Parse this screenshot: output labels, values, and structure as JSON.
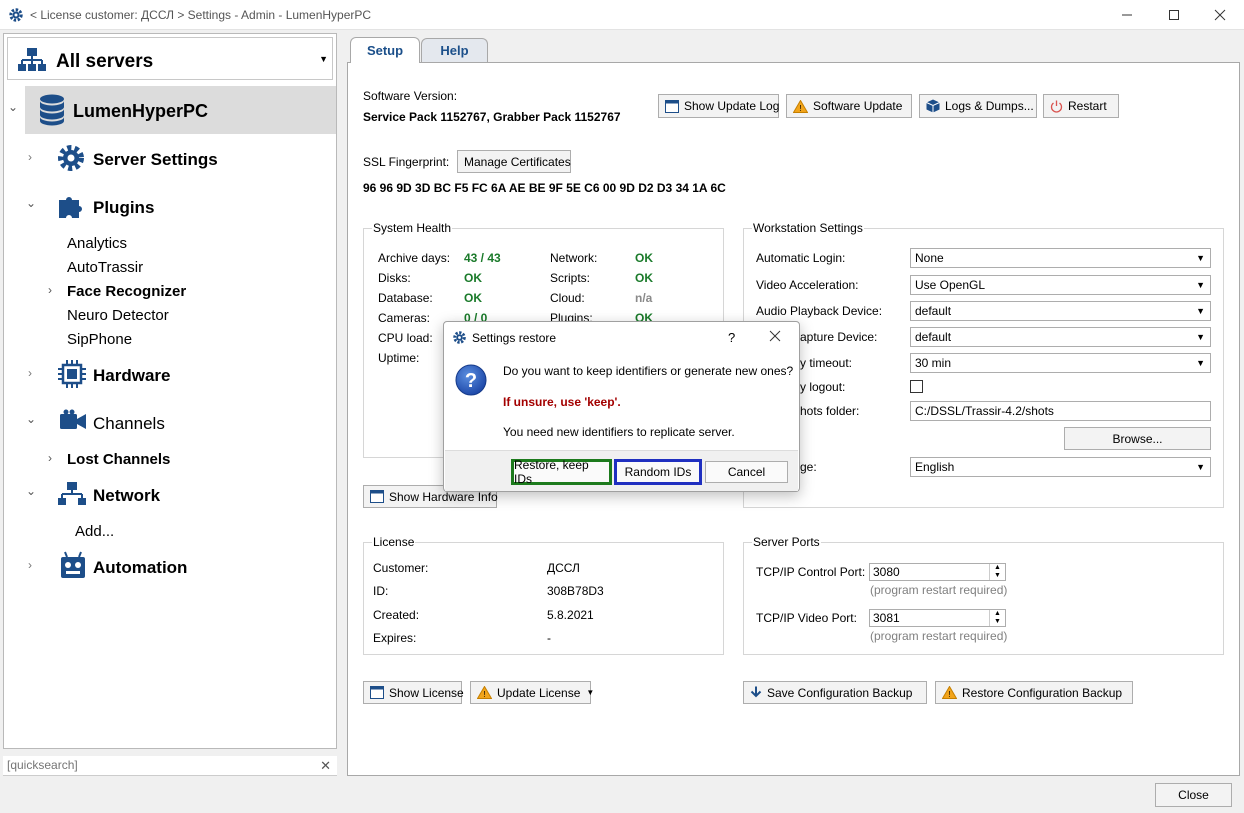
{
  "window": {
    "title": "< License customer: ДССЛ > Settings - Admin - LumenHyperPC"
  },
  "sidebar": {
    "server_selector": "All servers",
    "tree": [
      {
        "label": "LumenHyperPC"
      },
      {
        "label": "Server Settings"
      },
      {
        "label": "Plugins"
      },
      {
        "label": "Analytics"
      },
      {
        "label": "AutoTrassir"
      },
      {
        "label": "Face Recognizer"
      },
      {
        "label": "Neuro Detector"
      },
      {
        "label": "SipPhone"
      },
      {
        "label": "Hardware"
      },
      {
        "label": "Channels"
      },
      {
        "label": "Lost Channels"
      },
      {
        "label": "Network"
      },
      {
        "label": "Add..."
      },
      {
        "label": "Automation"
      }
    ],
    "quicksearch_placeholder": "[quicksearch]"
  },
  "tabs": [
    {
      "label": "Setup",
      "active": true
    },
    {
      "label": "Help",
      "active": false
    }
  ],
  "software": {
    "version_label": "Software Version:",
    "version_value": "Service Pack 1152767, Grabber Pack 1152767",
    "buttons": {
      "show_update_log": "Show Update Log",
      "software_update": "Software Update",
      "logs_dumps": "Logs & Dumps...",
      "restart": "Restart"
    }
  },
  "ssl": {
    "label": "SSL Fingerprint:",
    "manage_button": "Manage Certificates",
    "fingerprint": "96 96 9D 3D BC F5 FC 6A AE BE 9F 5E C6 00 9D D2 D3 34 1A 6C"
  },
  "system_health": {
    "title": "System Health",
    "left": [
      {
        "label": "Archive days:",
        "value": "43 / 43"
      },
      {
        "label": "Disks:",
        "value": "OK"
      },
      {
        "label": "Database:",
        "value": "OK"
      },
      {
        "label": "Cameras:",
        "value": "0 / 0"
      },
      {
        "label": "CPU load:",
        "value": ""
      },
      {
        "label": "Uptime:",
        "value": ""
      }
    ],
    "right": [
      {
        "label": "Network:",
        "value": "OK"
      },
      {
        "label": "Scripts:",
        "value": "OK"
      },
      {
        "label": "Cloud:",
        "value": "n/a"
      },
      {
        "label": "Plugins:",
        "value": "OK"
      }
    ],
    "show_hardware_info": "Show Hardware Info"
  },
  "workstation": {
    "title": "Workstation Settings",
    "automatic_login_label": "Automatic Login:",
    "automatic_login_value": "None",
    "video_accel_label": "Video Acceleration:",
    "video_accel_value": "Use OpenGL",
    "audio_playback_label": "Audio Playback Device:",
    "audio_playback_value": "default",
    "audio_capture_label": "apture Device:",
    "audio_capture_value": "default",
    "timeout_label": "y timeout:",
    "timeout_value": "30 min",
    "logout_label": "y logout:",
    "shots_label": "hots folder:",
    "shots_value": "C:/DSSL/Trassir-4.2/shots",
    "browse_button": "Browse...",
    "language_label": "ge:",
    "language_value": "English"
  },
  "license": {
    "title": "License",
    "rows": [
      {
        "label": "Customer:",
        "value": "ДССЛ"
      },
      {
        "label": "ID:",
        "value": "308B78D3"
      },
      {
        "label": "Created:",
        "value": "5.8.2021"
      },
      {
        "label": "Expires:",
        "value": "-"
      }
    ],
    "show_license": "Show License",
    "update_license": "Update License"
  },
  "server_ports": {
    "title": "Server Ports",
    "control_label": "TCP/IP Control Port:",
    "control_value": "3080",
    "video_label": "TCP/IP Video Port:",
    "video_value": "3081",
    "hint": "(program restart required)"
  },
  "backup": {
    "save": "Save Configuration Backup",
    "restore": "Restore Configuration Backup"
  },
  "dialog": {
    "title": "Settings restore",
    "help": "?",
    "question": "Do you want to keep identifiers or generate new ones?",
    "warning": "If unsure, use 'keep'.",
    "info": "You need new identifiers to replicate server.",
    "buttons": {
      "keep": "Restore, keep IDs",
      "random": "Random IDs",
      "cancel": "Cancel"
    },
    "colors": {
      "keep_border": "#1c7a1c",
      "random_border": "#1f2fc0",
      "warning": "#a30000"
    }
  },
  "close_button": "Close"
}
